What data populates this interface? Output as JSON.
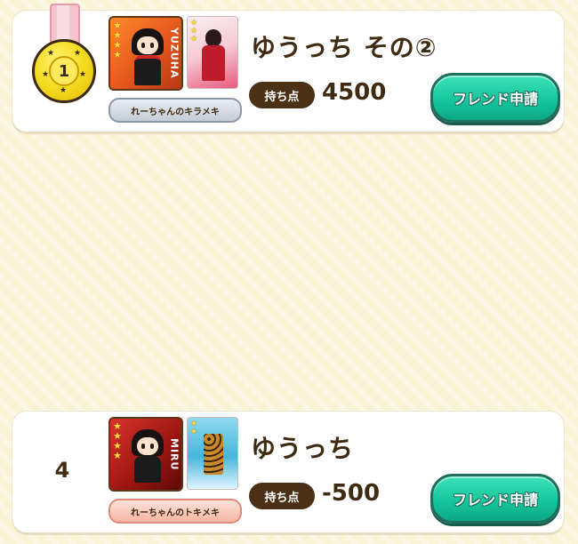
{
  "entries": [
    {
      "rank": "1",
      "character_side_label": "YUZUHA",
      "skill": "れーちゃんのキラメキ",
      "name": "ゆうっち その②",
      "points_label": "持ち点",
      "points": "4500",
      "friend_button": "フレンド申請"
    },
    {
      "rank": "4",
      "character_side_label": "MIRU",
      "skill": "れーちゃんのトキメキ",
      "name": "ゆうっち",
      "points_label": "持ち点",
      "points": "-500",
      "friend_button": "フレンド申請"
    }
  ],
  "colors": {
    "background": "#fbf3d6",
    "card": "#ffffff",
    "text": "#3f2a12",
    "button": "#14c39a"
  }
}
